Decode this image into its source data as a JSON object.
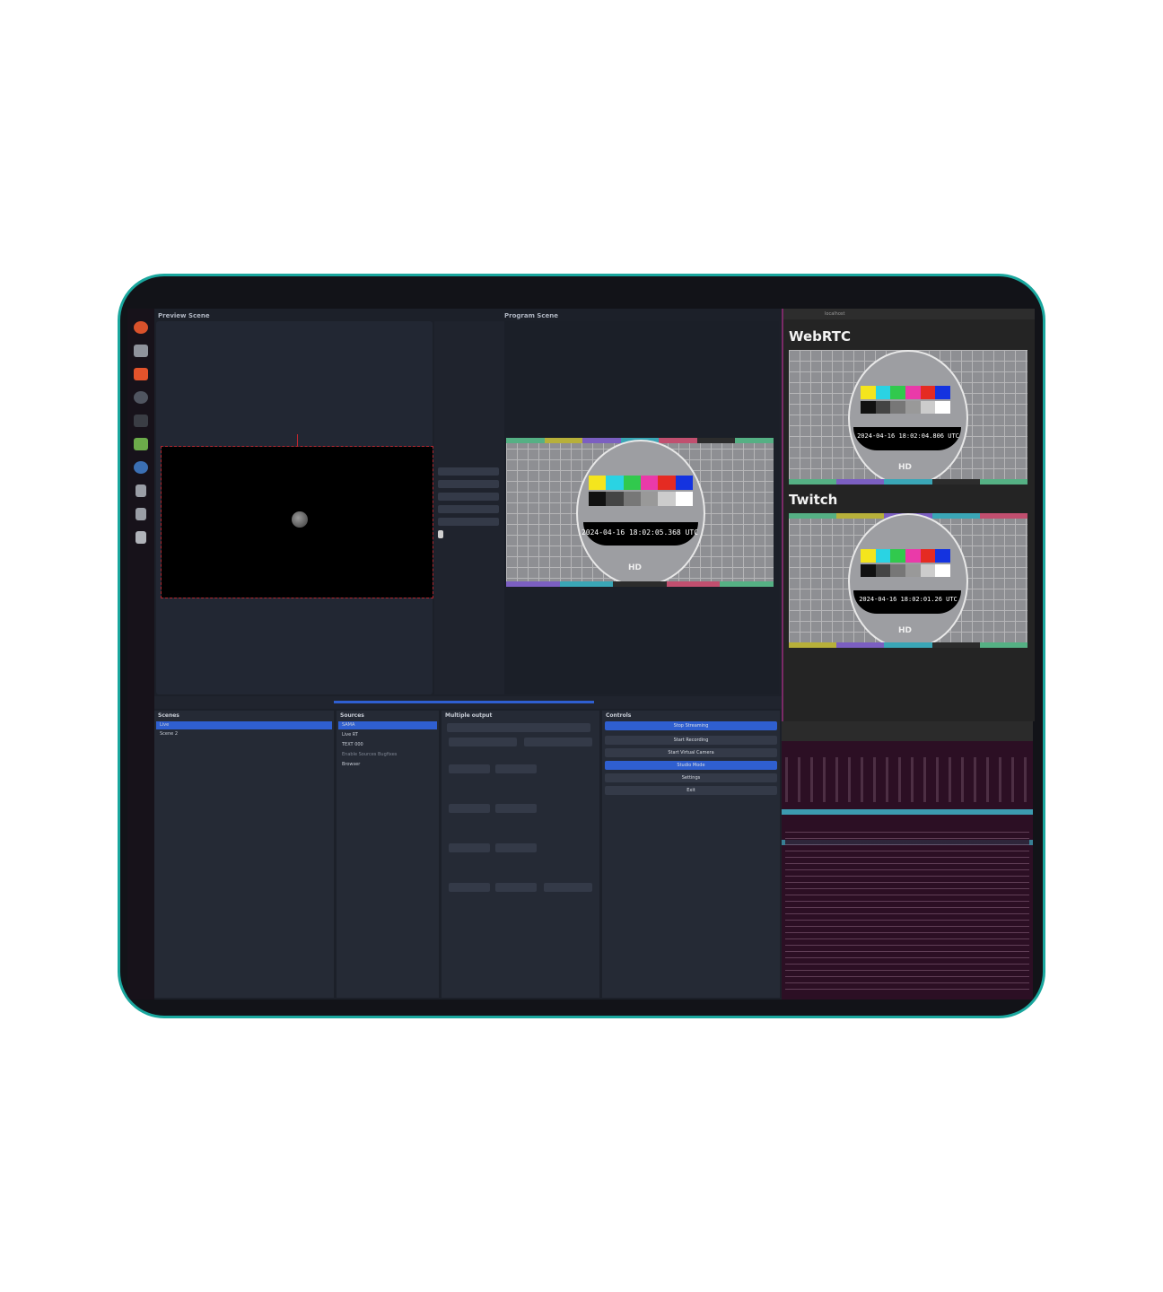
{
  "obs": {
    "preview_title": "Preview Scene",
    "program_title": "Program Scene",
    "scenes_title": "Scenes",
    "scenes": [
      "Live",
      "Scene 2"
    ],
    "sources_title": "Sources",
    "sources": [
      "SAMA",
      "Live RT",
      "TEXT 000",
      "Enable Sources Bugfixes",
      "Browser"
    ],
    "multiple_output_title": "Multiple output",
    "controls_title": "Controls",
    "controls": [
      "Stop Streaming",
      "Start Recording",
      "Start Virtual Camera",
      "Studio Mode",
      "Settings",
      "Exit"
    ]
  },
  "program_timestamp": "2024-04-16 18:02:05.368 UTC",
  "browser": {
    "url": "localhost",
    "webrtc_title": "WebRTC",
    "webrtc_timestamp": "2024-04-16 18:02:04.806 UTC",
    "twitch_title": "Twitch",
    "twitch_timestamp": "2024-04-16 18:02:01.26 UTC"
  },
  "colors": {
    "frame_border": "#1aa79e",
    "selection": "#2f5fd0",
    "terminal_bg": "#2c0f24"
  }
}
